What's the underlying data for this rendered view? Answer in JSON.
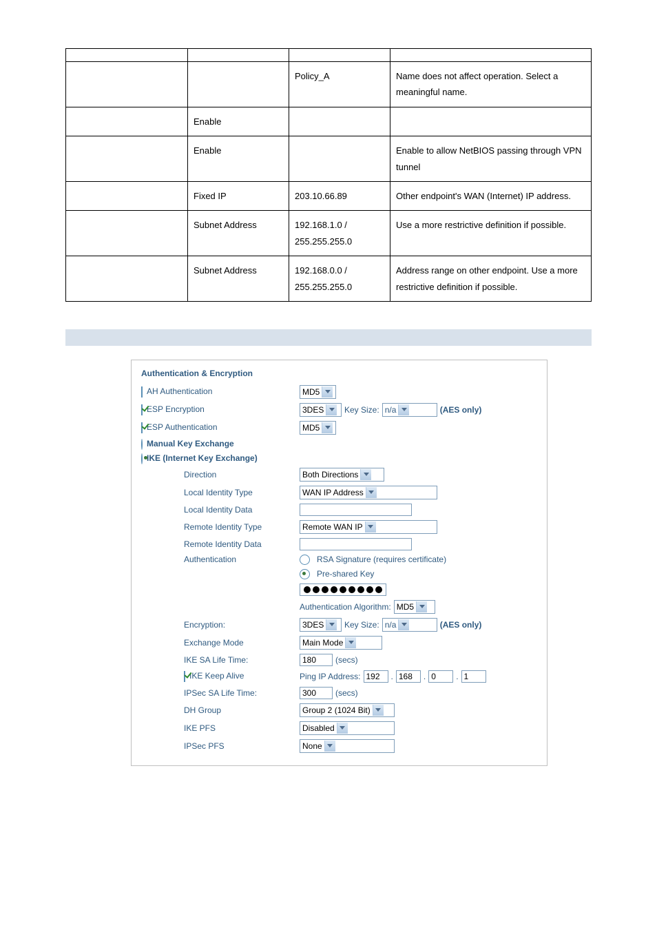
{
  "table": {
    "rows": [
      {
        "c1": "",
        "c2": "",
        "c3": "Policy_A",
        "c4": "Name does not affect operation. Select a meaningful name."
      },
      {
        "c1": "",
        "c2": "Enable",
        "c3": "",
        "c4": ""
      },
      {
        "c1": "",
        "c2": "Enable",
        "c3": "",
        "c4": "Enable to allow NetBIOS passing through VPN tunnel"
      },
      {
        "c1": "",
        "c2": "Fixed IP",
        "c3": "203.10.66.89",
        "c4": "Other endpoint's WAN (Internet) IP address."
      },
      {
        "c1": "",
        "c2": "Subnet Address",
        "c3": "192.168.1.0 / 255.255.255.0",
        "c4": "Use a more restrictive definition if possible."
      },
      {
        "c1": "",
        "c2": "Subnet Address",
        "c3": "192.168.0.0 / 255.255.255.0",
        "c4": "Address range on other endpoint. Use a more restrictive definition if possible."
      }
    ]
  },
  "panel": {
    "title": "Authentication & Encryption",
    "ah_auth_label": "AH Authentication",
    "ah_auth_select": "MD5",
    "esp_enc_label": "ESP Encryption",
    "esp_enc_select": "3DES",
    "key_size_label": "Key Size:",
    "key_size_value": "n/a",
    "aes_only": "(AES only)",
    "esp_auth_label": "ESP Authentication",
    "esp_auth_select": "MD5",
    "manual_key_label": "Manual Key Exchange",
    "ike_label": "IKE (Internet Key Exchange)",
    "direction_label": "Direction",
    "direction_value": "Both Directions",
    "local_id_type_label": "Local Identity Type",
    "local_id_type_value": "WAN IP Address",
    "local_id_data_label": "Local Identity Data",
    "remote_id_type_label": "Remote Identity Type",
    "remote_id_type_value": "Remote WAN IP",
    "remote_id_data_label": "Remote Identity Data",
    "auth_label": "Authentication",
    "rsa_label": "RSA Signature (requires certificate)",
    "psk_label": "Pre-shared Key",
    "auth_algo_label": "Authentication Algorithm:",
    "auth_algo_value": "MD5",
    "encryption_label": "Encryption:",
    "encryption_value": "3DES",
    "exchange_mode_label": "Exchange Mode",
    "exchange_mode_value": "Main Mode",
    "ike_sa_life_label": "IKE SA Life Time:",
    "ike_sa_life_value": "180",
    "secs": "(secs)",
    "ike_keepalive_label": "IKE Keep Alive",
    "ping_ip_label": "Ping IP Address:",
    "ping_ip": [
      "192",
      "168",
      "0",
      "1"
    ],
    "ipsec_sa_life_label": "IPSec SA Life Time:",
    "ipsec_sa_life_value": "300",
    "dh_group_label": "DH Group",
    "dh_group_value": "Group 2 (1024 Bit)",
    "ike_pfs_label": "IKE PFS",
    "ike_pfs_value": "Disabled",
    "ipsec_pfs_label": "IPSec PFS",
    "ipsec_pfs_value": "None"
  }
}
